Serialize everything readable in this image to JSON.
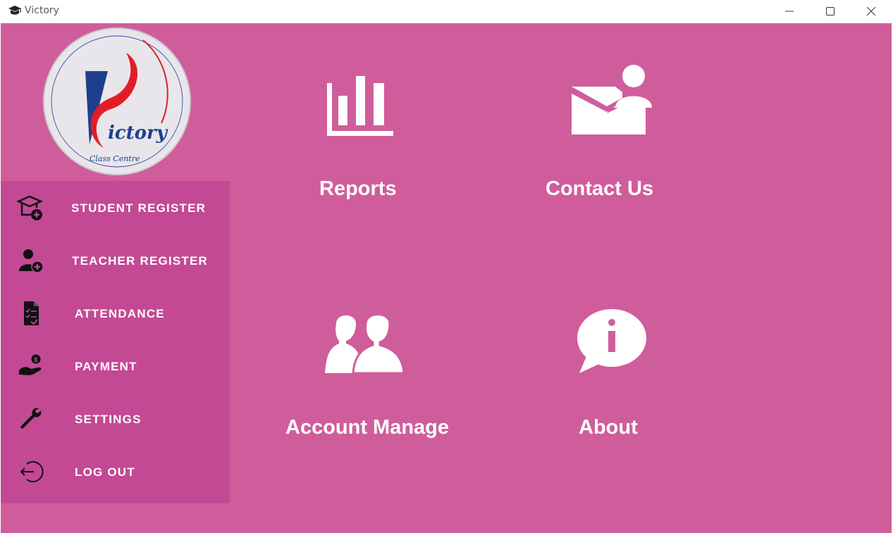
{
  "window": {
    "title": "Victory",
    "app_icon": "graduation-cap-icon",
    "controls": [
      "minimize-icon",
      "maximize-icon",
      "close-icon"
    ]
  },
  "colors": {
    "background": "#d05d9b",
    "sidebar": "#c34995",
    "text": "#ffffff",
    "logo_blue": "#1f3e8e",
    "logo_red": "#e21d27"
  },
  "logo": {
    "mark": "V",
    "name": "ictory",
    "subtitle": "Class Centre"
  },
  "sidebar": {
    "items": [
      {
        "label": "STUDENT REGISTER",
        "icon": "student-add-icon"
      },
      {
        "label": "TEACHER REGISTER",
        "icon": "user-add-icon"
      },
      {
        "label": "ATTENDANCE",
        "icon": "attendance-sheet-icon"
      },
      {
        "label": "PAYMENT",
        "icon": "payment-hand-icon"
      },
      {
        "label": "SETTINGS",
        "icon": "wrench-icon"
      },
      {
        "label": "LOG OUT",
        "icon": "logout-icon"
      }
    ]
  },
  "tiles": [
    {
      "label": "Reports",
      "icon": "bar-chart-icon"
    },
    {
      "label": "Contact Us",
      "icon": "mail-contact-icon"
    },
    {
      "label": "Account Manage",
      "icon": "users-icon"
    },
    {
      "label": "About",
      "icon": "info-bubble-icon"
    }
  ]
}
